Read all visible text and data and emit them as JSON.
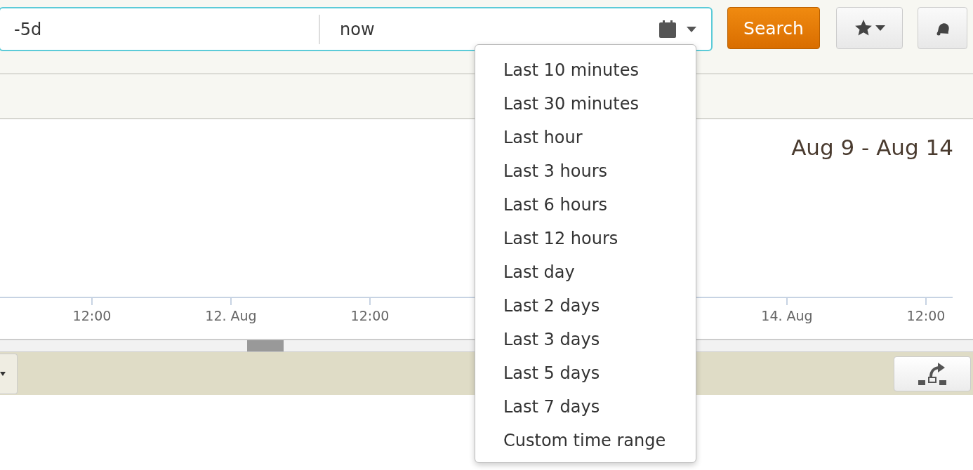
{
  "time_range": {
    "earliest": "-5d",
    "latest": "now"
  },
  "search_button": "Search",
  "chart": {
    "title": "Aug 9 - Aug 14",
    "axis_labels": [
      "12:00",
      "12. Aug",
      "12:00",
      "14. Aug",
      "12:00"
    ]
  },
  "presets_menu": {
    "items": [
      "Last 10 minutes",
      "Last 30 minutes",
      "Last hour",
      "Last 3 hours",
      "Last 6 hours",
      "Last 12 hours",
      "Last day",
      "Last 2 days",
      "Last 3 days",
      "Last 5 days",
      "Last 7 days",
      "Custom time range"
    ]
  }
}
